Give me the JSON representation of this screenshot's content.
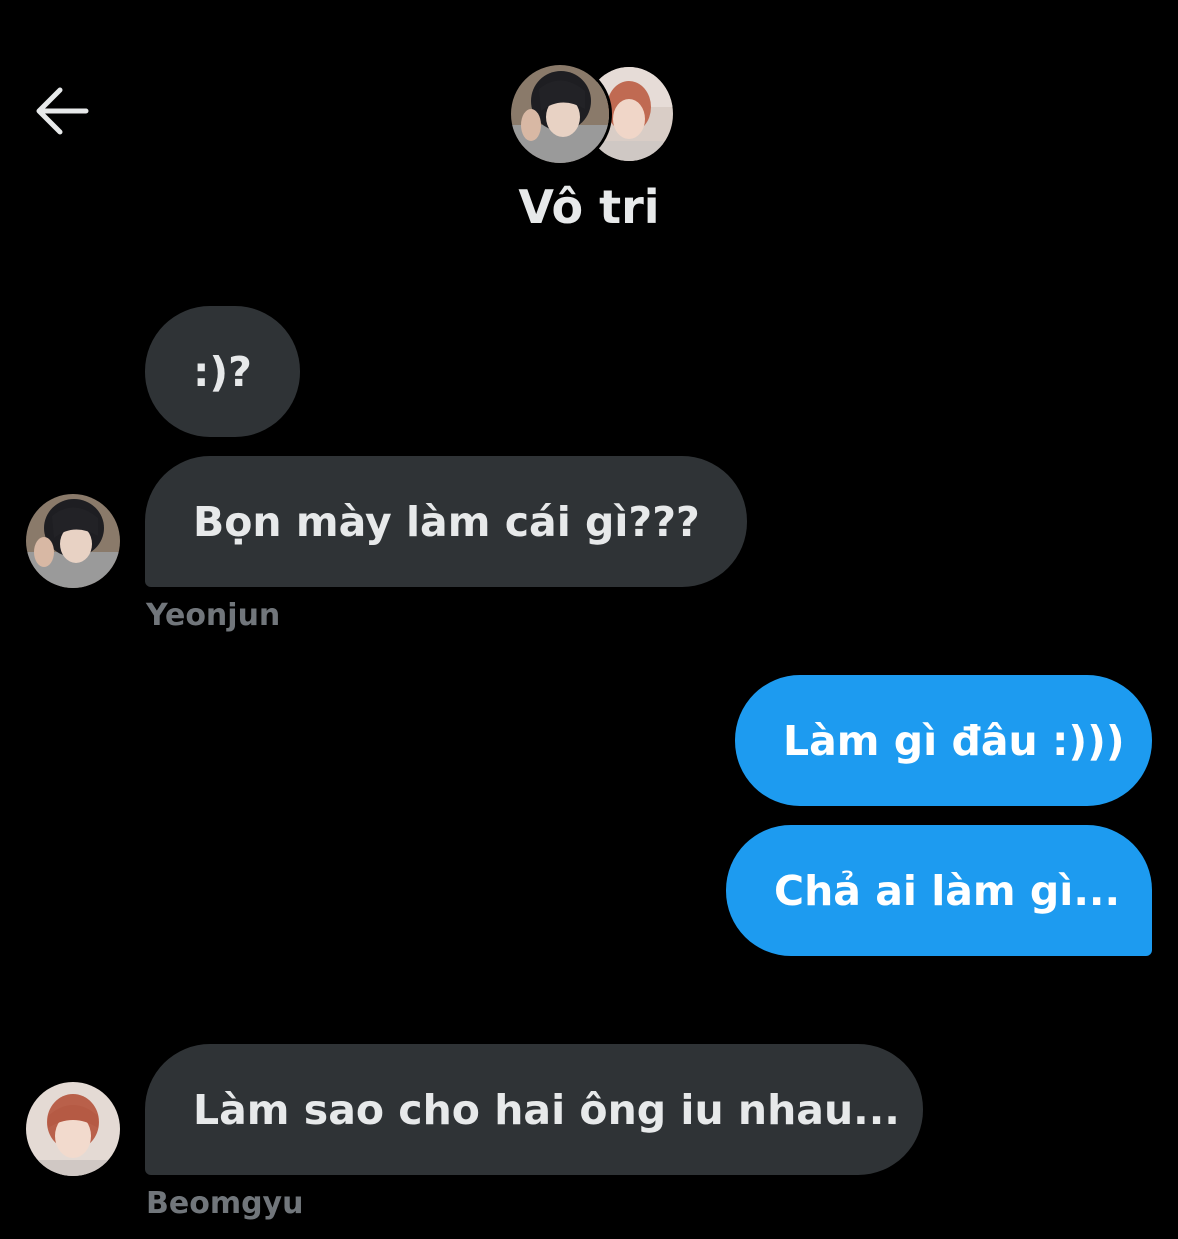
{
  "header": {
    "title": "Vô tri",
    "back_icon": "arrow-left-icon"
  },
  "colors": {
    "background": "#000000",
    "incoming_bubble": "#2f3336",
    "outgoing_bubble": "#1d9bf0",
    "text_primary": "#e7e9ea",
    "text_secondary": "#71767b"
  },
  "messages": [
    {
      "direction": "incoming",
      "text": ":)?"
    },
    {
      "direction": "incoming",
      "text": "Bọn mày làm cái gì???",
      "sender": "Yeonjun"
    },
    {
      "direction": "outgoing",
      "text": "Làm gì đâu :)))"
    },
    {
      "direction": "outgoing",
      "text": "Chả ai làm gì..."
    },
    {
      "direction": "incoming",
      "text": "Làm sao cho hai ông iu nhau...",
      "sender": "Beomgyu"
    }
  ]
}
